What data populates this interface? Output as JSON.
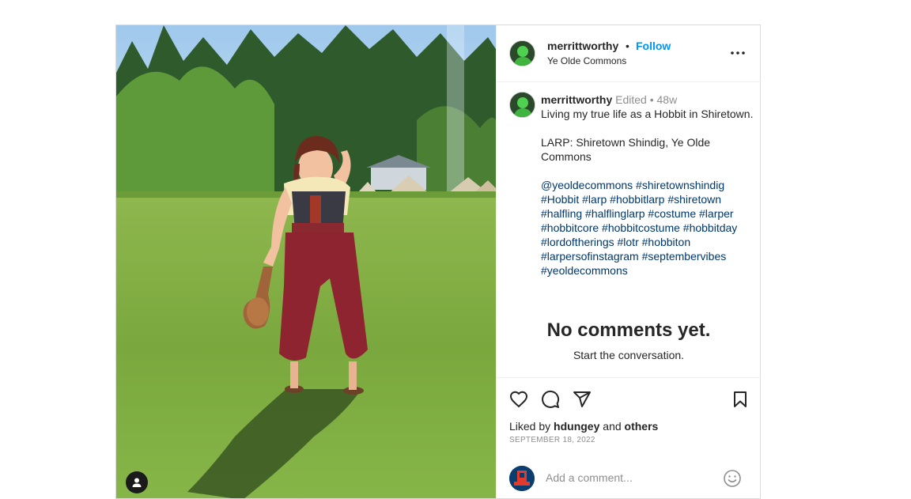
{
  "post": {
    "username": "merrittworthy",
    "follow_label": "Follow",
    "separator": "•",
    "location": "Ye Olde Commons",
    "more_icon": "more-horizontal-icon",
    "photo_alt": "Woman in hobbit costume holding a guitar on a grassy field with tents and forest behind",
    "tag_icon": "user-tag-icon"
  },
  "caption": {
    "username": "merrittworthy",
    "edited": "Edited",
    "dot": "•",
    "age": "48w",
    "line1": "Living my true life as a Hobbit in Shiretown.",
    "line2": "LARP: Shiretown Shindig, Ye Olde Commons",
    "hashtags": "@yeoldecommons #shiretownshindig #Hobbit #larp #hobbitlarp #shiretown #halfling #halflinglarp #costume #larper #hobbitcore #hobbitcostume #hobbitday #lordoftherings #lotr #hobbiton #larpersofinstagram #septembervibes #yeoldecommons"
  },
  "comments": {
    "empty_title": "No comments yet.",
    "empty_sub": "Start the conversation."
  },
  "actions": {
    "like_icon": "heart-icon",
    "comment_icon": "comment-icon",
    "share_icon": "share-icon",
    "save_icon": "bookmark-icon",
    "liked_prefix": "Liked by",
    "liked_user": "hdungey",
    "liked_and": "and",
    "liked_others": "others",
    "date": "SEPTEMBER 18, 2022"
  },
  "add_comment": {
    "placeholder": "Add a comment...",
    "emoji_icon": "emoji-icon"
  },
  "colors": {
    "link_blue": "#0095f6",
    "hashtag": "#00376b",
    "muted": "#8e8e8e"
  }
}
